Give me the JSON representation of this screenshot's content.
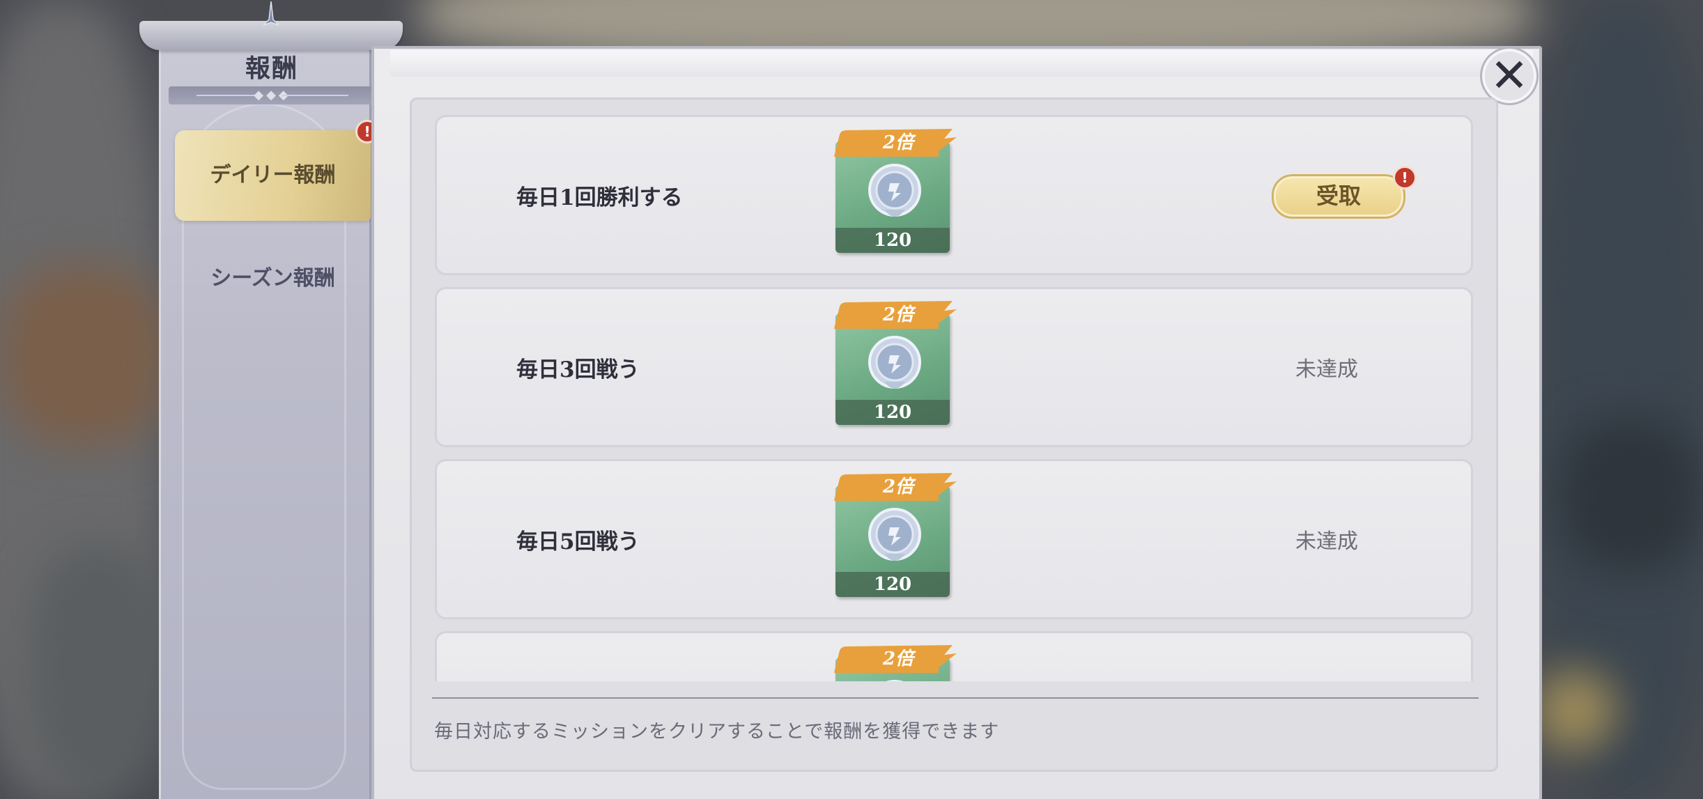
{
  "sidebar": {
    "title": "報酬",
    "tabs": [
      {
        "label": "デイリー報酬",
        "selected": true,
        "alert": "!"
      },
      {
        "label": "シーズン報酬",
        "selected": false
      }
    ]
  },
  "close_icon": "✕",
  "missions": [
    {
      "label": "毎日1回勝利する",
      "multiplier": "2倍",
      "reward_count": "120",
      "status": "受取",
      "claimable": true,
      "alert": "!"
    },
    {
      "label": "毎日3回戦う",
      "multiplier": "2倍",
      "reward_count": "120",
      "status": "未達成",
      "claimable": false
    },
    {
      "label": "毎日5回戦う",
      "multiplier": "2倍",
      "reward_count": "120",
      "status": "未達成",
      "claimable": false
    },
    {
      "label": "",
      "multiplier": "2倍",
      "reward_count": "",
      "status": "",
      "claimable": false
    }
  ],
  "footer": {
    "note": "毎日対応するミッションをクリアすることで報酬を獲得できます"
  },
  "colors": {
    "accent_gold": "#e9d088",
    "alert_red": "#c0392b",
    "reward_tile": "#6aa882",
    "ribbon_orange": "#e8a03c"
  }
}
